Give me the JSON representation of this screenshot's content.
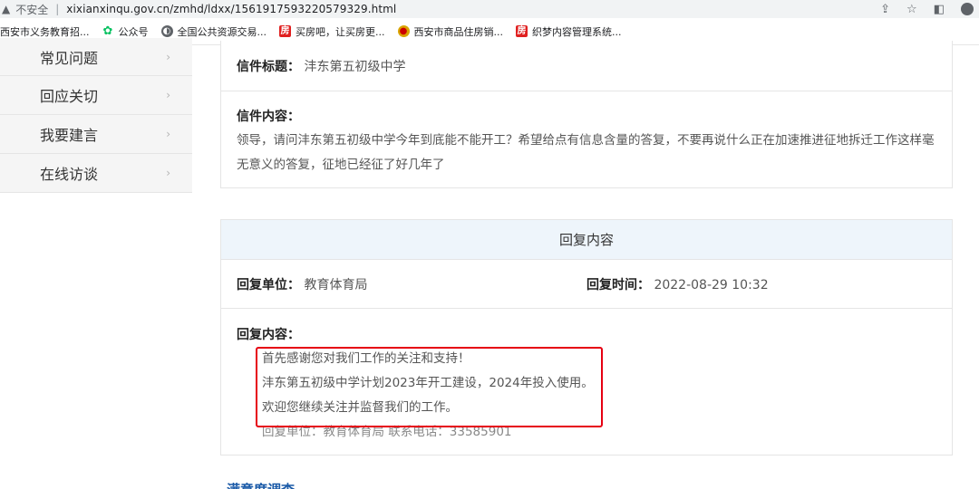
{
  "browser": {
    "security_label": "不安全",
    "url": "xixianxinqu.gov.cn/zmhd/ldxx/1561917593220579329.html"
  },
  "bookmarks": [
    {
      "label": "西安市义务教育招...",
      "icon": "none"
    },
    {
      "label": "公众号",
      "icon": "wechat-icon"
    },
    {
      "label": "全国公共资源交易...",
      "icon": "globe-icon"
    },
    {
      "label": "买房吧，让买房更...",
      "icon": "fang-icon",
      "icon_text": "房"
    },
    {
      "label": "西安市商品住房销...",
      "icon": "gov-emblem-icon"
    },
    {
      "label": "织梦内容管理系统...",
      "icon": "fang-icon",
      "icon_text": "房"
    }
  ],
  "sidebar": {
    "items": [
      {
        "label": "常见问题"
      },
      {
        "label": "回应关切"
      },
      {
        "label": "我要建言"
      },
      {
        "label": "在线访谈"
      }
    ]
  },
  "letter": {
    "title_label": "信件标题：",
    "title_value": "沣东第五初级中学",
    "content_label": "信件内容：",
    "content_text": "领导，请问沣东第五初级中学今年到底能不能开工？希望给点有信息含量的答复，不要再说什么正在加速推进征地拆迁工作这样毫无意义的答复，征地已经征了好几年了"
  },
  "reply": {
    "heading": "回复内容",
    "unit_label": "回复单位：",
    "unit_value": "教育体育局",
    "time_label": "回复时间：",
    "time_value": "2022-08-29 10:32",
    "content_label": "回复内容：",
    "lines": [
      "首先感谢您对我们工作的关注和支持！",
      "沣东第五初级中学计划2023年开工建设，2024年投入使用。",
      "欢迎您继续关注并监督我们的工作。",
      "回复单位：教育体育局 联系电话：33585901"
    ]
  },
  "survey": {
    "title": "满意度调查"
  },
  "colors": {
    "highlight": "#e60012",
    "reply_header_bg": "#eef5fb",
    "link_blue": "#1a5aa8"
  }
}
